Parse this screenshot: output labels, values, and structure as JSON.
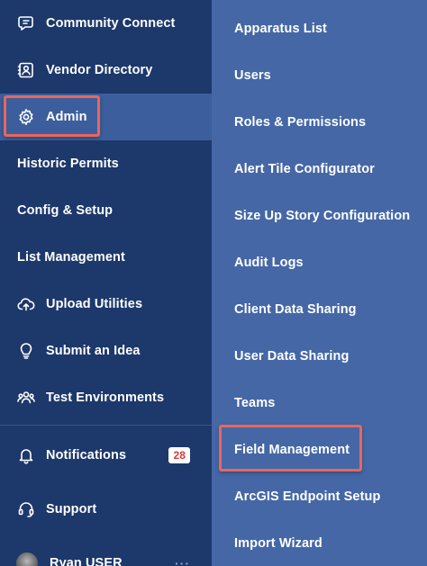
{
  "sidebar": {
    "items": [
      {
        "label": "Community Connect",
        "icon": "chat-bubble-icon"
      },
      {
        "label": "Vendor Directory",
        "icon": "contact-card-icon"
      },
      {
        "label": "Admin",
        "icon": "gear-icon",
        "active": true
      },
      {
        "label": "Historic Permits"
      },
      {
        "label": "Config & Setup"
      },
      {
        "label": "List Management"
      },
      {
        "label": "Upload Utilities",
        "icon": "cloud-upload-icon"
      },
      {
        "label": "Submit an Idea",
        "icon": "lightbulb-icon"
      },
      {
        "label": "Test Environments",
        "icon": "users-icon"
      }
    ],
    "footer": {
      "notifications": {
        "label": "Notifications",
        "icon": "bell-icon",
        "badge": "28"
      },
      "support": {
        "label": "Support",
        "icon": "headset-icon"
      },
      "user": {
        "name": "Ryan USER",
        "more": "···"
      }
    }
  },
  "submenu": {
    "items": [
      {
        "label": "Apparatus List"
      },
      {
        "label": "Users"
      },
      {
        "label": "Roles & Permissions"
      },
      {
        "label": "Alert Tile Configurator"
      },
      {
        "label": "Size Up Story Configuration"
      },
      {
        "label": "Audit Logs"
      },
      {
        "label": "Client Data Sharing"
      },
      {
        "label": "User Data Sharing"
      },
      {
        "label": "Teams"
      },
      {
        "label": "Field Management",
        "highlighted": true
      },
      {
        "label": "ArcGIS Endpoint Setup"
      },
      {
        "label": "Import Wizard"
      }
    ]
  },
  "colors": {
    "sidebar_bg": "#1d386b",
    "submenu_bg": "#4567a6",
    "active_bg": "#3d5e9c",
    "highlight_border": "#e8675d",
    "badge_text": "#d63a3a"
  }
}
